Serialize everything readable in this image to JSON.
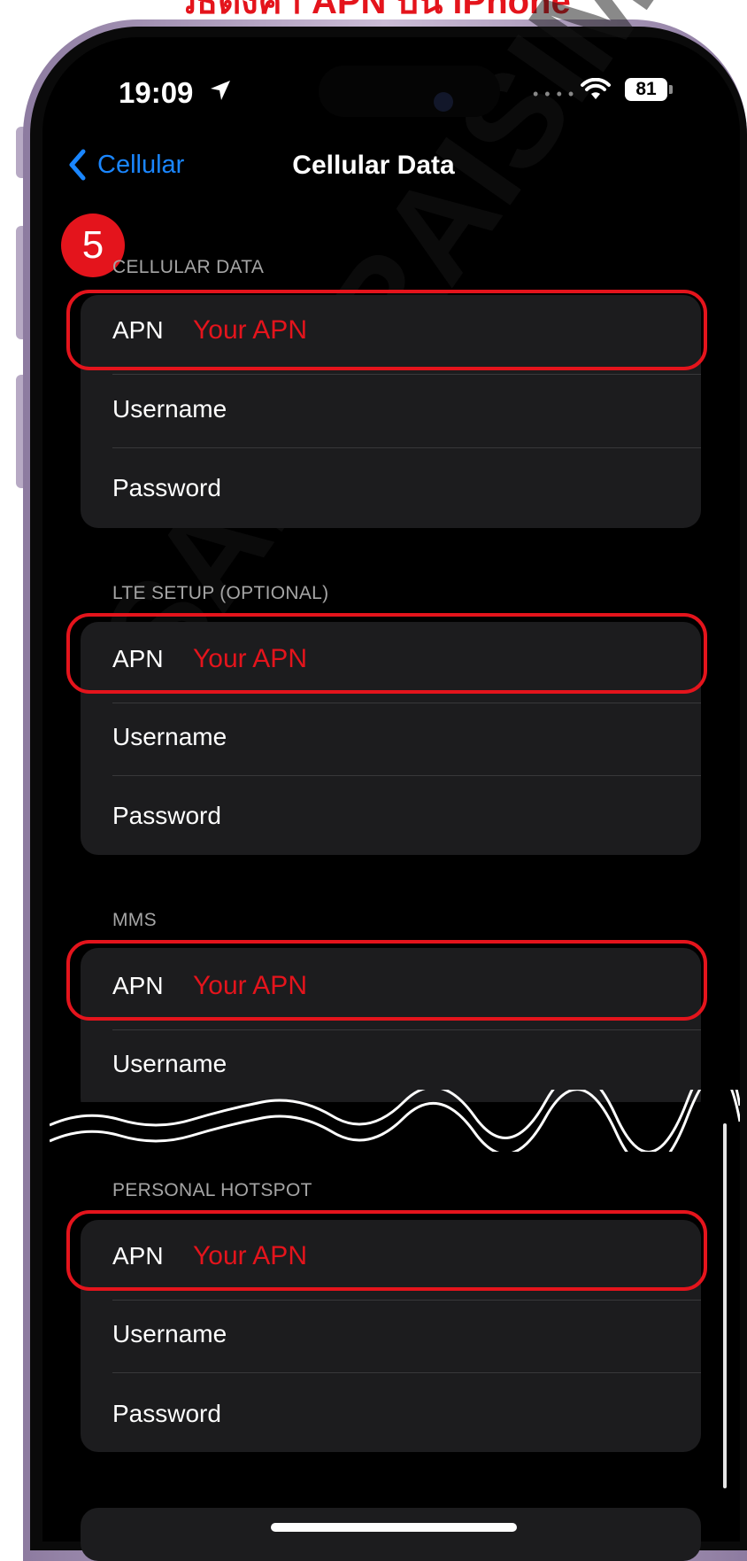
{
  "banner": {
    "text": "วิธีตั้งค่า APN บน iPhone"
  },
  "status_bar": {
    "time": "19:09",
    "signal_icon": "signal-dots-icon",
    "wifi_icon": "wifi-icon",
    "battery_level": "81"
  },
  "nav": {
    "back_label": "Cellular",
    "title": "Cellular Data"
  },
  "step_badge": "5",
  "sections": [
    {
      "header": "CELLULAR DATA",
      "rows": [
        {
          "label": "APN",
          "value": "Your APN"
        },
        {
          "label": "Username",
          "value": ""
        },
        {
          "label": "Password",
          "value": ""
        }
      ]
    },
    {
      "header": "LTE SETUP (OPTIONAL)",
      "rows": [
        {
          "label": "APN",
          "value": "Your APN"
        },
        {
          "label": "Username",
          "value": ""
        },
        {
          "label": "Password",
          "value": ""
        }
      ]
    },
    {
      "header": "MMS",
      "rows": [
        {
          "label": "APN",
          "value": "Your APN"
        },
        {
          "label": "Username",
          "value": ""
        }
      ]
    },
    {
      "header": "PERSONAL HOTSPOT",
      "rows": [
        {
          "label": "APN",
          "value": "Your APN"
        },
        {
          "label": "Username",
          "value": ""
        },
        {
          "label": "Password",
          "value": ""
        }
      ]
    }
  ],
  "watermark": "SAMURAISIM",
  "colors": {
    "accent_red": "#e4141c",
    "ios_blue": "#1a86ff",
    "cell_background": "#1c1c1e",
    "screen_background": "#000000"
  }
}
